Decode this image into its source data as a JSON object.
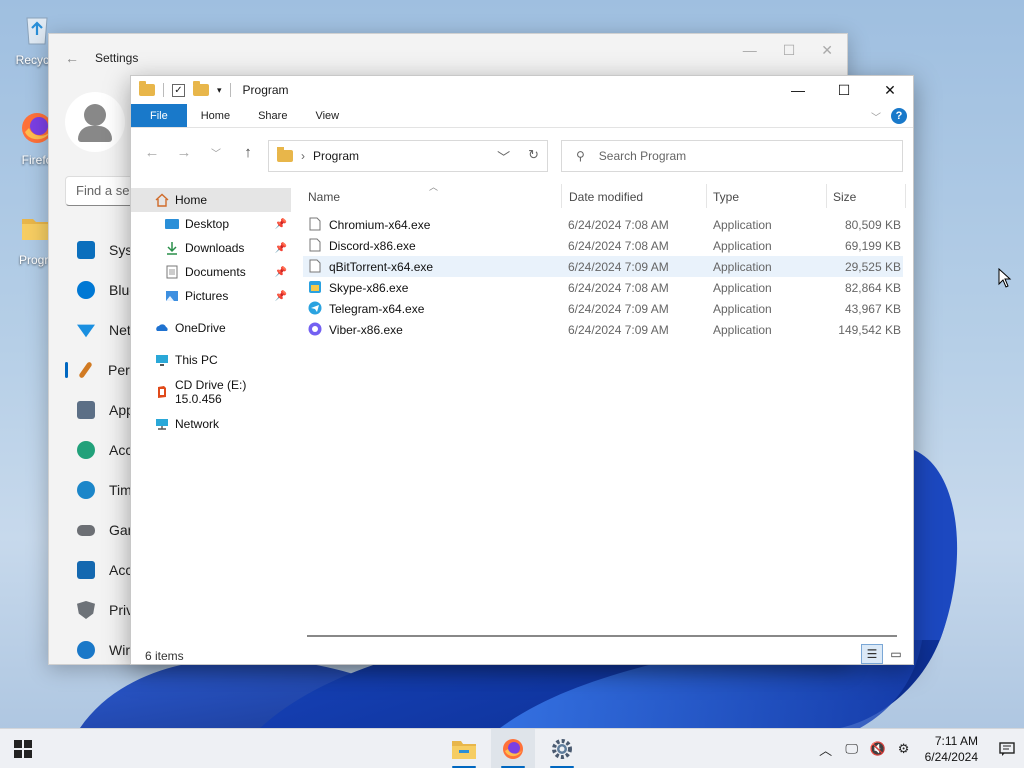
{
  "desktop": {
    "icons": [
      {
        "label": "Recycle",
        "icon": "recycle-bin-icon"
      },
      {
        "label": "Firefo",
        "icon": "firefox-icon"
      },
      {
        "label": "Progra",
        "icon": "folder-icon"
      }
    ]
  },
  "settings_window": {
    "title": "Settings",
    "search_placeholder": "Find a se",
    "nav": [
      {
        "label": "Syst",
        "icon": "system-icon",
        "color": "#0b6fbd"
      },
      {
        "label": "Blue",
        "icon": "bluetooth-icon",
        "color": "#0078d4"
      },
      {
        "label": "Net",
        "icon": "network-icon",
        "color": "#1a8fe0"
      },
      {
        "label": "Pers",
        "icon": "personalization-icon",
        "color": "#d17a22"
      },
      {
        "label": "App",
        "icon": "apps-icon",
        "color": "#5c6f86"
      },
      {
        "label": "Acc",
        "icon": "accounts-icon",
        "color": "#21a17a"
      },
      {
        "label": "Tim",
        "icon": "time-language-icon",
        "color": "#1c86c9"
      },
      {
        "label": "Gar",
        "icon": "gaming-icon",
        "color": "#6c6f74"
      },
      {
        "label": "Acc",
        "icon": "accessibility-icon",
        "color": "#1468b0"
      },
      {
        "label": "Priv",
        "icon": "privacy-shield-icon",
        "color": "#6d7278"
      },
      {
        "label": "Wir",
        "icon": "windows-update-icon",
        "color": "#1a78c8"
      }
    ]
  },
  "explorer": {
    "title": "Program",
    "ribbon_tabs": [
      "File",
      "Home",
      "Share",
      "View"
    ],
    "breadcrumb": "Program",
    "search_placeholder": "Search Program",
    "nav_pane": [
      {
        "label": "Home",
        "icon": "home-icon",
        "selected": true,
        "sub": false,
        "pinned": false
      },
      {
        "label": "Desktop",
        "icon": "desktop-icon",
        "selected": false,
        "sub": true,
        "pinned": true
      },
      {
        "label": "Downloads",
        "icon": "downloads-icon",
        "selected": false,
        "sub": true,
        "pinned": true
      },
      {
        "label": "Documents",
        "icon": "documents-icon",
        "selected": false,
        "sub": true,
        "pinned": true
      },
      {
        "label": "Pictures",
        "icon": "pictures-icon",
        "selected": false,
        "sub": true,
        "pinned": true
      },
      {
        "label": "OneDrive",
        "icon": "onedrive-icon",
        "selected": false,
        "sub": false,
        "pinned": false
      },
      {
        "label": "This PC",
        "icon": "this-pc-icon",
        "selected": false,
        "sub": false,
        "pinned": false
      },
      {
        "label": "CD Drive (E:) 15.0.456",
        "icon": "cd-drive-icon",
        "selected": false,
        "sub": false,
        "pinned": false
      },
      {
        "label": "Network",
        "icon": "network-icon",
        "selected": false,
        "sub": false,
        "pinned": false
      }
    ],
    "columns": [
      "Name",
      "Date modified",
      "Type",
      "Size"
    ],
    "files": [
      {
        "name": "Chromium-x64.exe",
        "date": "6/24/2024 7:08 AM",
        "type": "Application",
        "size": "80,509 KB",
        "icon": "exe-file-icon"
      },
      {
        "name": "Discord-x86.exe",
        "date": "6/24/2024 7:08 AM",
        "type": "Application",
        "size": "69,199 KB",
        "icon": "exe-file-icon"
      },
      {
        "name": "qBitTorrent-x64.exe",
        "date": "6/24/2024 7:09 AM",
        "type": "Application",
        "size": "29,525 KB",
        "icon": "exe-file-icon"
      },
      {
        "name": "Skype-x86.exe",
        "date": "6/24/2024 7:08 AM",
        "type": "Application",
        "size": "82,864 KB",
        "icon": "skype-installer-icon"
      },
      {
        "name": "Telegram-x64.exe",
        "date": "6/24/2024 7:09 AM",
        "type": "Application",
        "size": "43,967 KB",
        "icon": "telegram-icon"
      },
      {
        "name": "Viber-x86.exe",
        "date": "6/24/2024 7:09 AM",
        "type": "Application",
        "size": "149,542 KB",
        "icon": "viber-icon"
      }
    ],
    "highlighted_row": 2,
    "status": "6 items"
  },
  "taskbar": {
    "apps": [
      {
        "name": "file-explorer",
        "active": true
      },
      {
        "name": "firefox",
        "active": true
      },
      {
        "name": "settings",
        "active": false
      }
    ],
    "time": "7:11 AM",
    "date": "6/24/2024"
  },
  "colors": {
    "accent": "#0067c0",
    "ribbon_file": "#1979ca",
    "row_highlight": "#e9f2fb"
  }
}
